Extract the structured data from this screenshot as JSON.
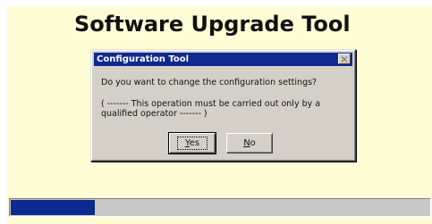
{
  "app": {
    "title": "Software Upgrade Tool"
  },
  "dialog": {
    "title": "Configuration Tool",
    "message": "Do you want to change the configuration settings?",
    "warning": "( ------- This operation must be carried out only by a qualified operator ------- )",
    "buttons": {
      "yes": {
        "accel": "Y",
        "rest": "es"
      },
      "no": {
        "accel": "N",
        "rest": "o"
      }
    }
  },
  "progress": {
    "fraction": 0.2
  },
  "colors": {
    "panel_background": "#fffdd6",
    "title_bar": "#0c2a8f",
    "dialog_face": "#d4d0c8",
    "progress_fill": "#0c2a8f",
    "progress_track": "#c8c8c8"
  },
  "icons": {
    "close": "close-icon"
  }
}
